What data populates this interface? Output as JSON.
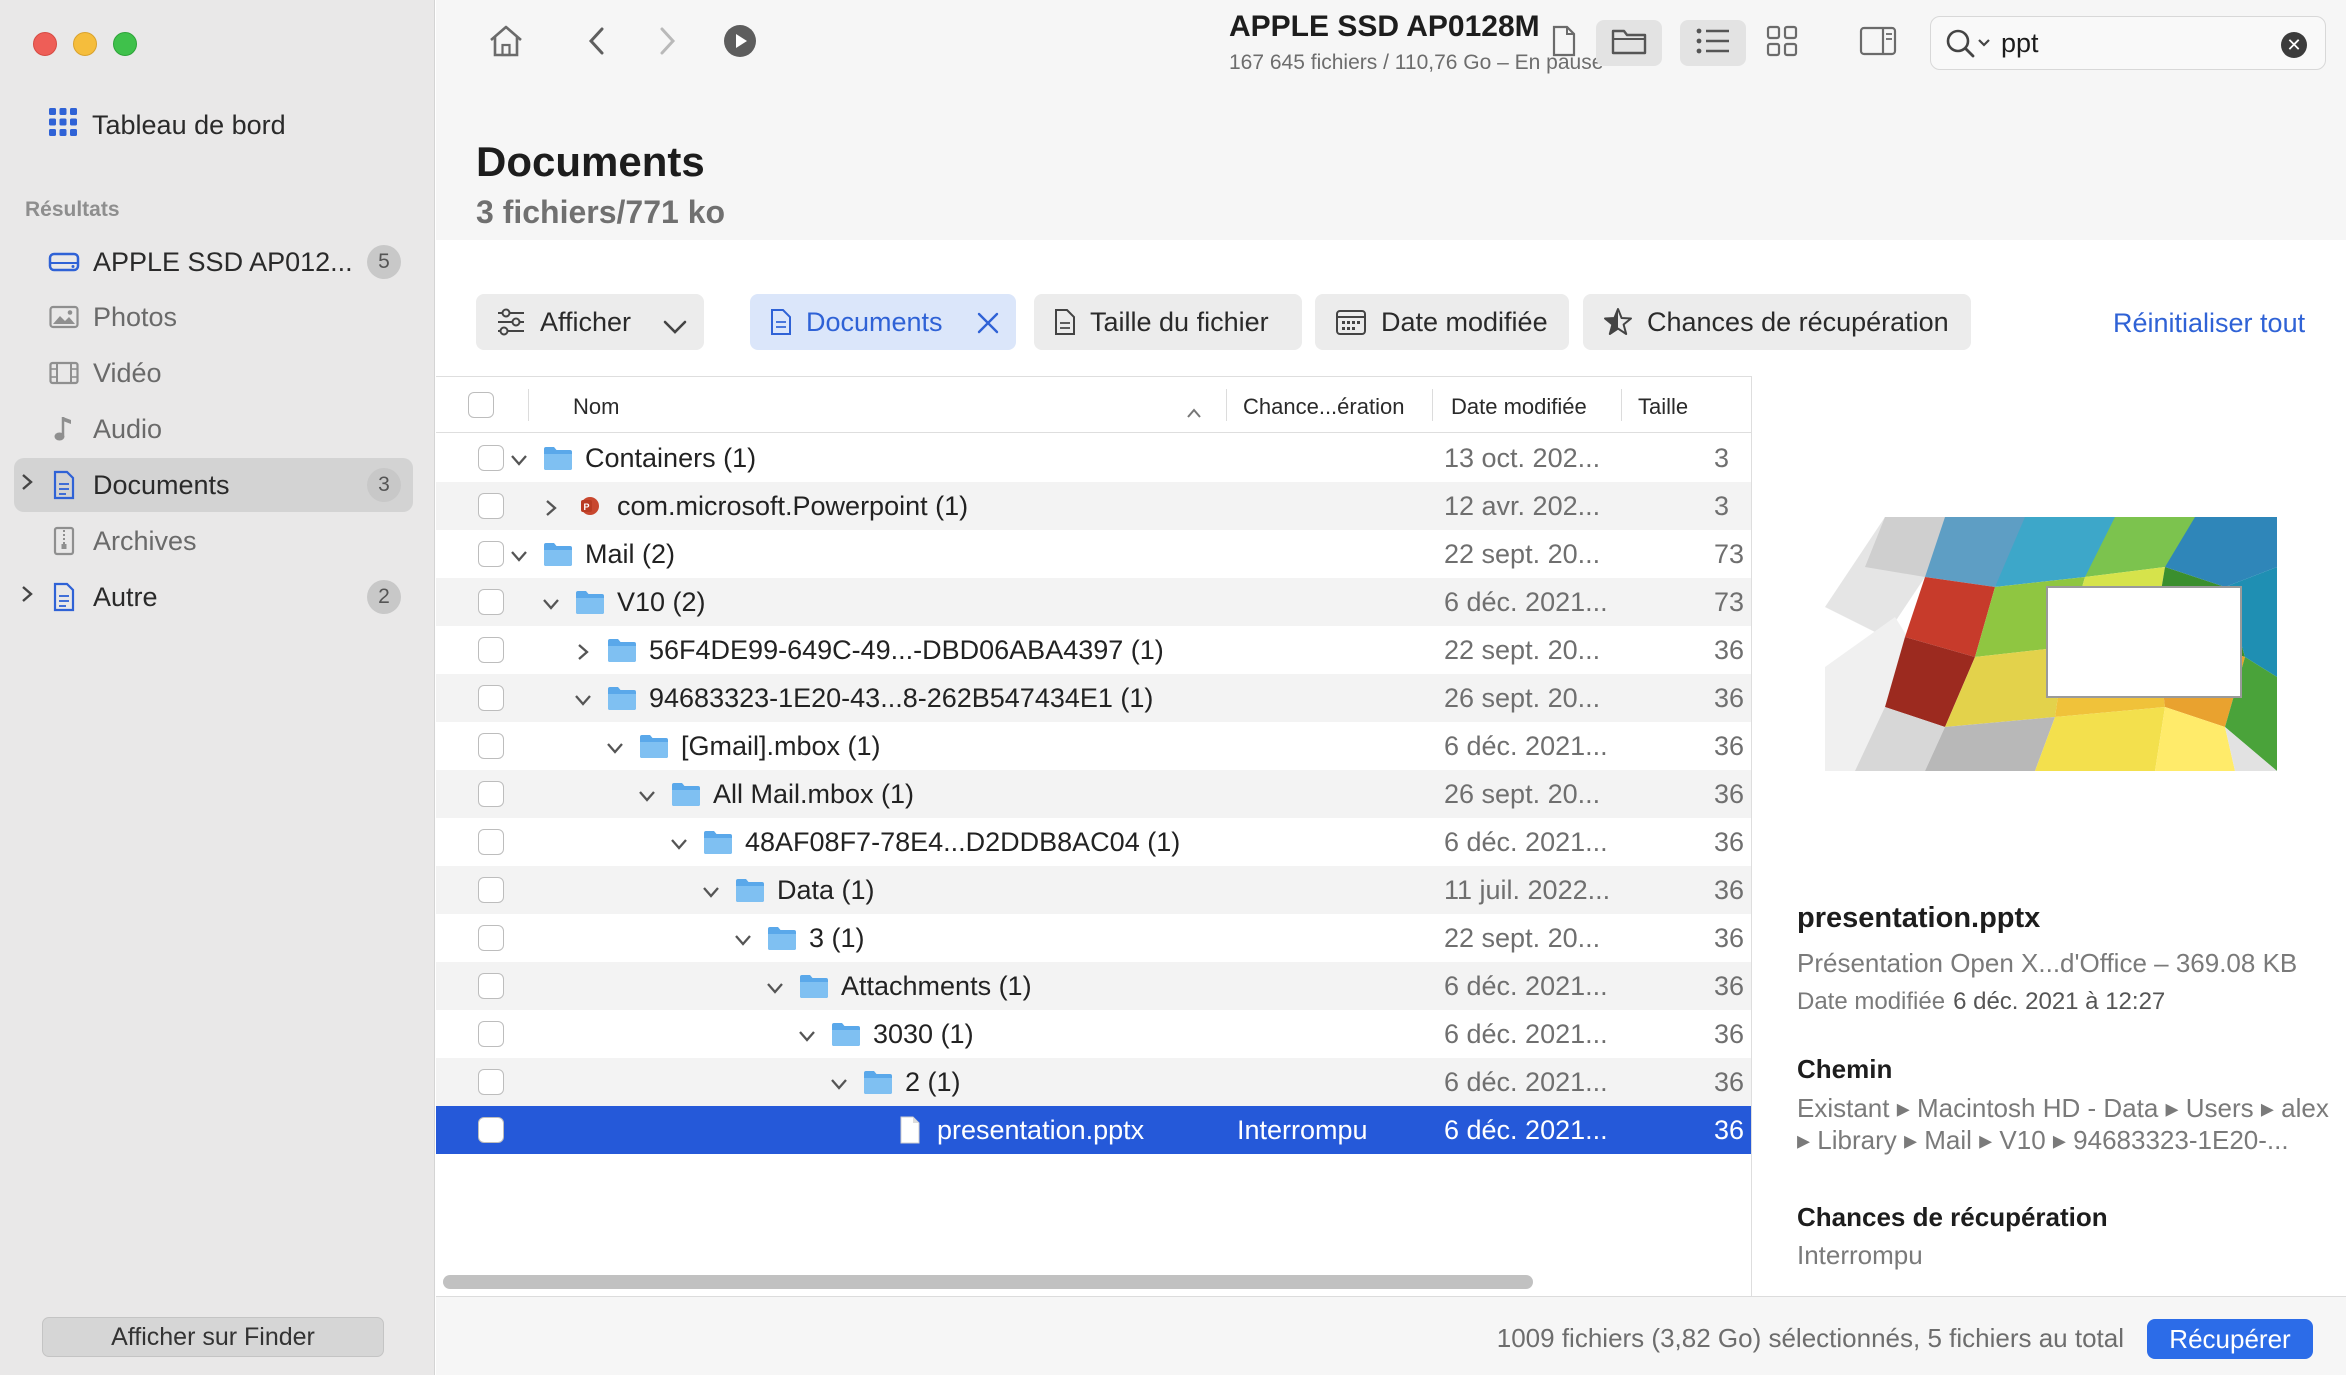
{
  "window": {
    "title": "APPLE SSD AP0128M",
    "subtitle": "167 645 fichiers / 110,76 Go – En pause"
  },
  "sidebar": {
    "dashboard_label": "Tableau de bord",
    "section_label": "Résultats",
    "items": [
      {
        "label": "APPLE SSD AP012...",
        "badge": "5",
        "icon": "drive-icon"
      },
      {
        "label": "Photos",
        "badge": "",
        "icon": "photo-icon"
      },
      {
        "label": "Vidéo",
        "badge": "",
        "icon": "film-icon"
      },
      {
        "label": "Audio",
        "badge": "",
        "icon": "music-note-icon"
      },
      {
        "label": "Documents",
        "badge": "3",
        "icon": "document-icon",
        "selected": true
      },
      {
        "label": "Archives",
        "badge": "",
        "icon": "archive-icon"
      },
      {
        "label": "Autre",
        "badge": "2",
        "icon": "document-icon"
      }
    ],
    "finder_button": "Afficher sur Finder"
  },
  "search": {
    "value": "ppt",
    "clear_symbol": "✕"
  },
  "header": {
    "title": "Documents",
    "subtitle": "3 fichiers/771 ko"
  },
  "filters": {
    "show_label": "Afficher",
    "active_filter": "Documents",
    "size_label": "Taille du fichier",
    "date_label": "Date modifiée",
    "chance_label": "Chances de récupération",
    "reset_label": "Réinitialiser tout"
  },
  "table": {
    "columns": {
      "name": "Nom",
      "chance": "Chance...ération",
      "date": "Date modifiée",
      "size": "Taille"
    },
    "rows": [
      {
        "name": "Containers (1)",
        "depth": 0,
        "expanded": true,
        "type": "folder",
        "chance": "",
        "date": "13 oct. 202...",
        "size": "3"
      },
      {
        "name": "com.microsoft.Powerpoint (1)",
        "depth": 1,
        "expanded": false,
        "type": "app",
        "chance": "",
        "date": "12 avr. 202...",
        "size": "3"
      },
      {
        "name": "Mail (2)",
        "depth": 0,
        "expanded": true,
        "type": "folder",
        "chance": "",
        "date": "22 sept. 20...",
        "size": "73"
      },
      {
        "name": "V10 (2)",
        "depth": 1,
        "expanded": true,
        "type": "folder",
        "chance": "",
        "date": "6 déc. 2021...",
        "size": "73"
      },
      {
        "name": "56F4DE99-649C-49...-DBD06ABA4397 (1)",
        "depth": 2,
        "expanded": false,
        "type": "folder",
        "chance": "",
        "date": "22 sept. 20...",
        "size": "36"
      },
      {
        "name": "94683323-1E20-43...8-262B547434E1 (1)",
        "depth": 2,
        "expanded": true,
        "type": "folder",
        "chance": "",
        "date": "26 sept. 20...",
        "size": "36"
      },
      {
        "name": "[Gmail].mbox (1)",
        "depth": 3,
        "expanded": true,
        "type": "folder",
        "chance": "",
        "date": "6 déc. 2021...",
        "size": "36"
      },
      {
        "name": "All Mail.mbox (1)",
        "depth": 4,
        "expanded": true,
        "type": "folder",
        "chance": "",
        "date": "26 sept. 20...",
        "size": "36"
      },
      {
        "name": "48AF08F7-78E4...D2DDB8AC04 (1)",
        "depth": 5,
        "expanded": true,
        "type": "folder",
        "chance": "",
        "date": "6 déc. 2021...",
        "size": "36"
      },
      {
        "name": "Data (1)",
        "depth": 6,
        "expanded": true,
        "type": "folder",
        "chance": "",
        "date": "11 juil. 2022...",
        "size": "36"
      },
      {
        "name": "3 (1)",
        "depth": 7,
        "expanded": true,
        "type": "folder",
        "chance": "",
        "date": "22 sept. 20...",
        "size": "36"
      },
      {
        "name": "Attachments (1)",
        "depth": 8,
        "expanded": true,
        "type": "folder",
        "chance": "",
        "date": "6 déc. 2021...",
        "size": "36"
      },
      {
        "name": "3030 (1)",
        "depth": 9,
        "expanded": true,
        "type": "folder",
        "chance": "",
        "date": "6 déc. 2021...",
        "size": "36"
      },
      {
        "name": "2 (1)",
        "depth": 10,
        "expanded": true,
        "type": "folder",
        "chance": "",
        "date": "6 déc. 2021...",
        "size": "36"
      },
      {
        "name": "presentation.pptx",
        "depth": 11,
        "expanded": null,
        "type": "file",
        "chance": "Interrompu",
        "date": "6 déc. 2021...",
        "size": "36",
        "selected": true
      }
    ]
  },
  "preview": {
    "file_name": "presentation.pptx",
    "file_type": "Présentation Open X...d'Office – 369.08 KB",
    "modified_label": "Date modifiée",
    "modified_value": "6 déc. 2021 à 12:27",
    "path_heading": "Chemin",
    "path_value": "Existant ▸ Macintosh HD - Data ▸ Users ▸ alex ▸ Library ▸ Mail ▸ V10 ▸ 94683323-1E20-...",
    "chance_heading": "Chances de récupération",
    "chance_value": "Interrompu"
  },
  "footer": {
    "status": "1009 fichiers (3,82 Go) sélectionnés, 5 fichiers au total",
    "recover_button": "Récupérer"
  },
  "colors": {
    "accent": "#2f62d6",
    "selection": "#2559d9",
    "folder": "#5aa8ea",
    "sidebar_bg": "#e9e8e8"
  }
}
